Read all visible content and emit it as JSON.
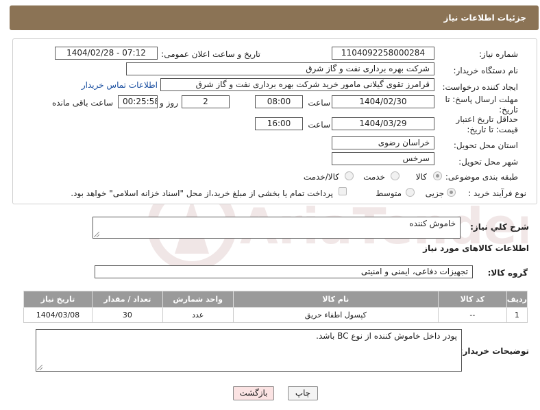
{
  "header": {
    "title": "جزئیات اطلاعات نیاز"
  },
  "form": {
    "need_number_label": "شماره نیاز:",
    "need_number": "1104092258000284",
    "announce_label": "تاریخ و ساعت اعلان عمومی:",
    "announce_value": "1404/02/28 - 07:12",
    "buyer_org_label": "نام دستگاه خریدار:",
    "buyer_org": "شرکت بهره برداری نفت و گاز شرق",
    "creator_label": "ایجاد کننده درخواست:",
    "creator": "قرامرز تقوی گیلانی مامور خرید شرکت بهره برداری نفت و گاز شرق",
    "contact_link": "اطلاعات تماس خریدار",
    "reply_deadline_label": "مهلت ارسال پاسخ: تا تاریخ:",
    "reply_date": "1404/02/30",
    "time_label": "ساعت",
    "reply_time": "08:00",
    "days_value": "2",
    "days_label": "روز و",
    "remaining_time": "00:25:58",
    "remaining_label": "ساعت باقی مانده",
    "price_validity_label": "حداقل تاریخ اعتبار قیمت: تا تاریخ:",
    "price_date": "1404/03/29",
    "price_time": "16:00",
    "province_label": "استان محل تحویل:",
    "province": "خراسان رضوی",
    "city_label": "شهر محل تحویل:",
    "city": "سرخس",
    "category_label": "طبقه بندی موضوعی:",
    "category_options": [
      "کالا",
      "خدمت",
      "کالا/خدمت"
    ],
    "process_label": "نوع فرآیند خرید :",
    "process_options": [
      "جزیی",
      "متوسط"
    ],
    "payment_note": "پرداخت تمام یا بخشی از مبلغ خرید،از محل \"اسناد خزانه اسلامی\" خواهد بود."
  },
  "summary": {
    "label": "شرح کلي نياز:",
    "value": "خاموش کننده"
  },
  "goods": {
    "section_title": "اطلاعات کالاهای مورد نیاز",
    "group_label": "گروه کالا:",
    "group_value": "تجهیزات دفاعی، ایمنی و امنیتی",
    "columns": [
      "ردیف",
      "کد کالا",
      "نام کالا",
      "واحد شمارش",
      "تعداد / مقدار",
      "تاریخ نیاز"
    ],
    "rows": [
      [
        "1",
        "--",
        "کپسول اطفاء حریق",
        "عدد",
        "30",
        "1404/03/08"
      ]
    ]
  },
  "buyer_notes": {
    "label": "توضیحات خریدار:",
    "value": "پودر داخل خاموش کننده از نوع BC باشد."
  },
  "buttons": {
    "print": "چاپ",
    "back": "بازگشت"
  },
  "watermark": {
    "text": "AriaTender.net"
  },
  "colors": {
    "header_bg": "#8b7355",
    "table_header_bg": "#9a9a9a",
    "back_button_bg": "#fbe3e3",
    "link": "#1a4fa0"
  }
}
